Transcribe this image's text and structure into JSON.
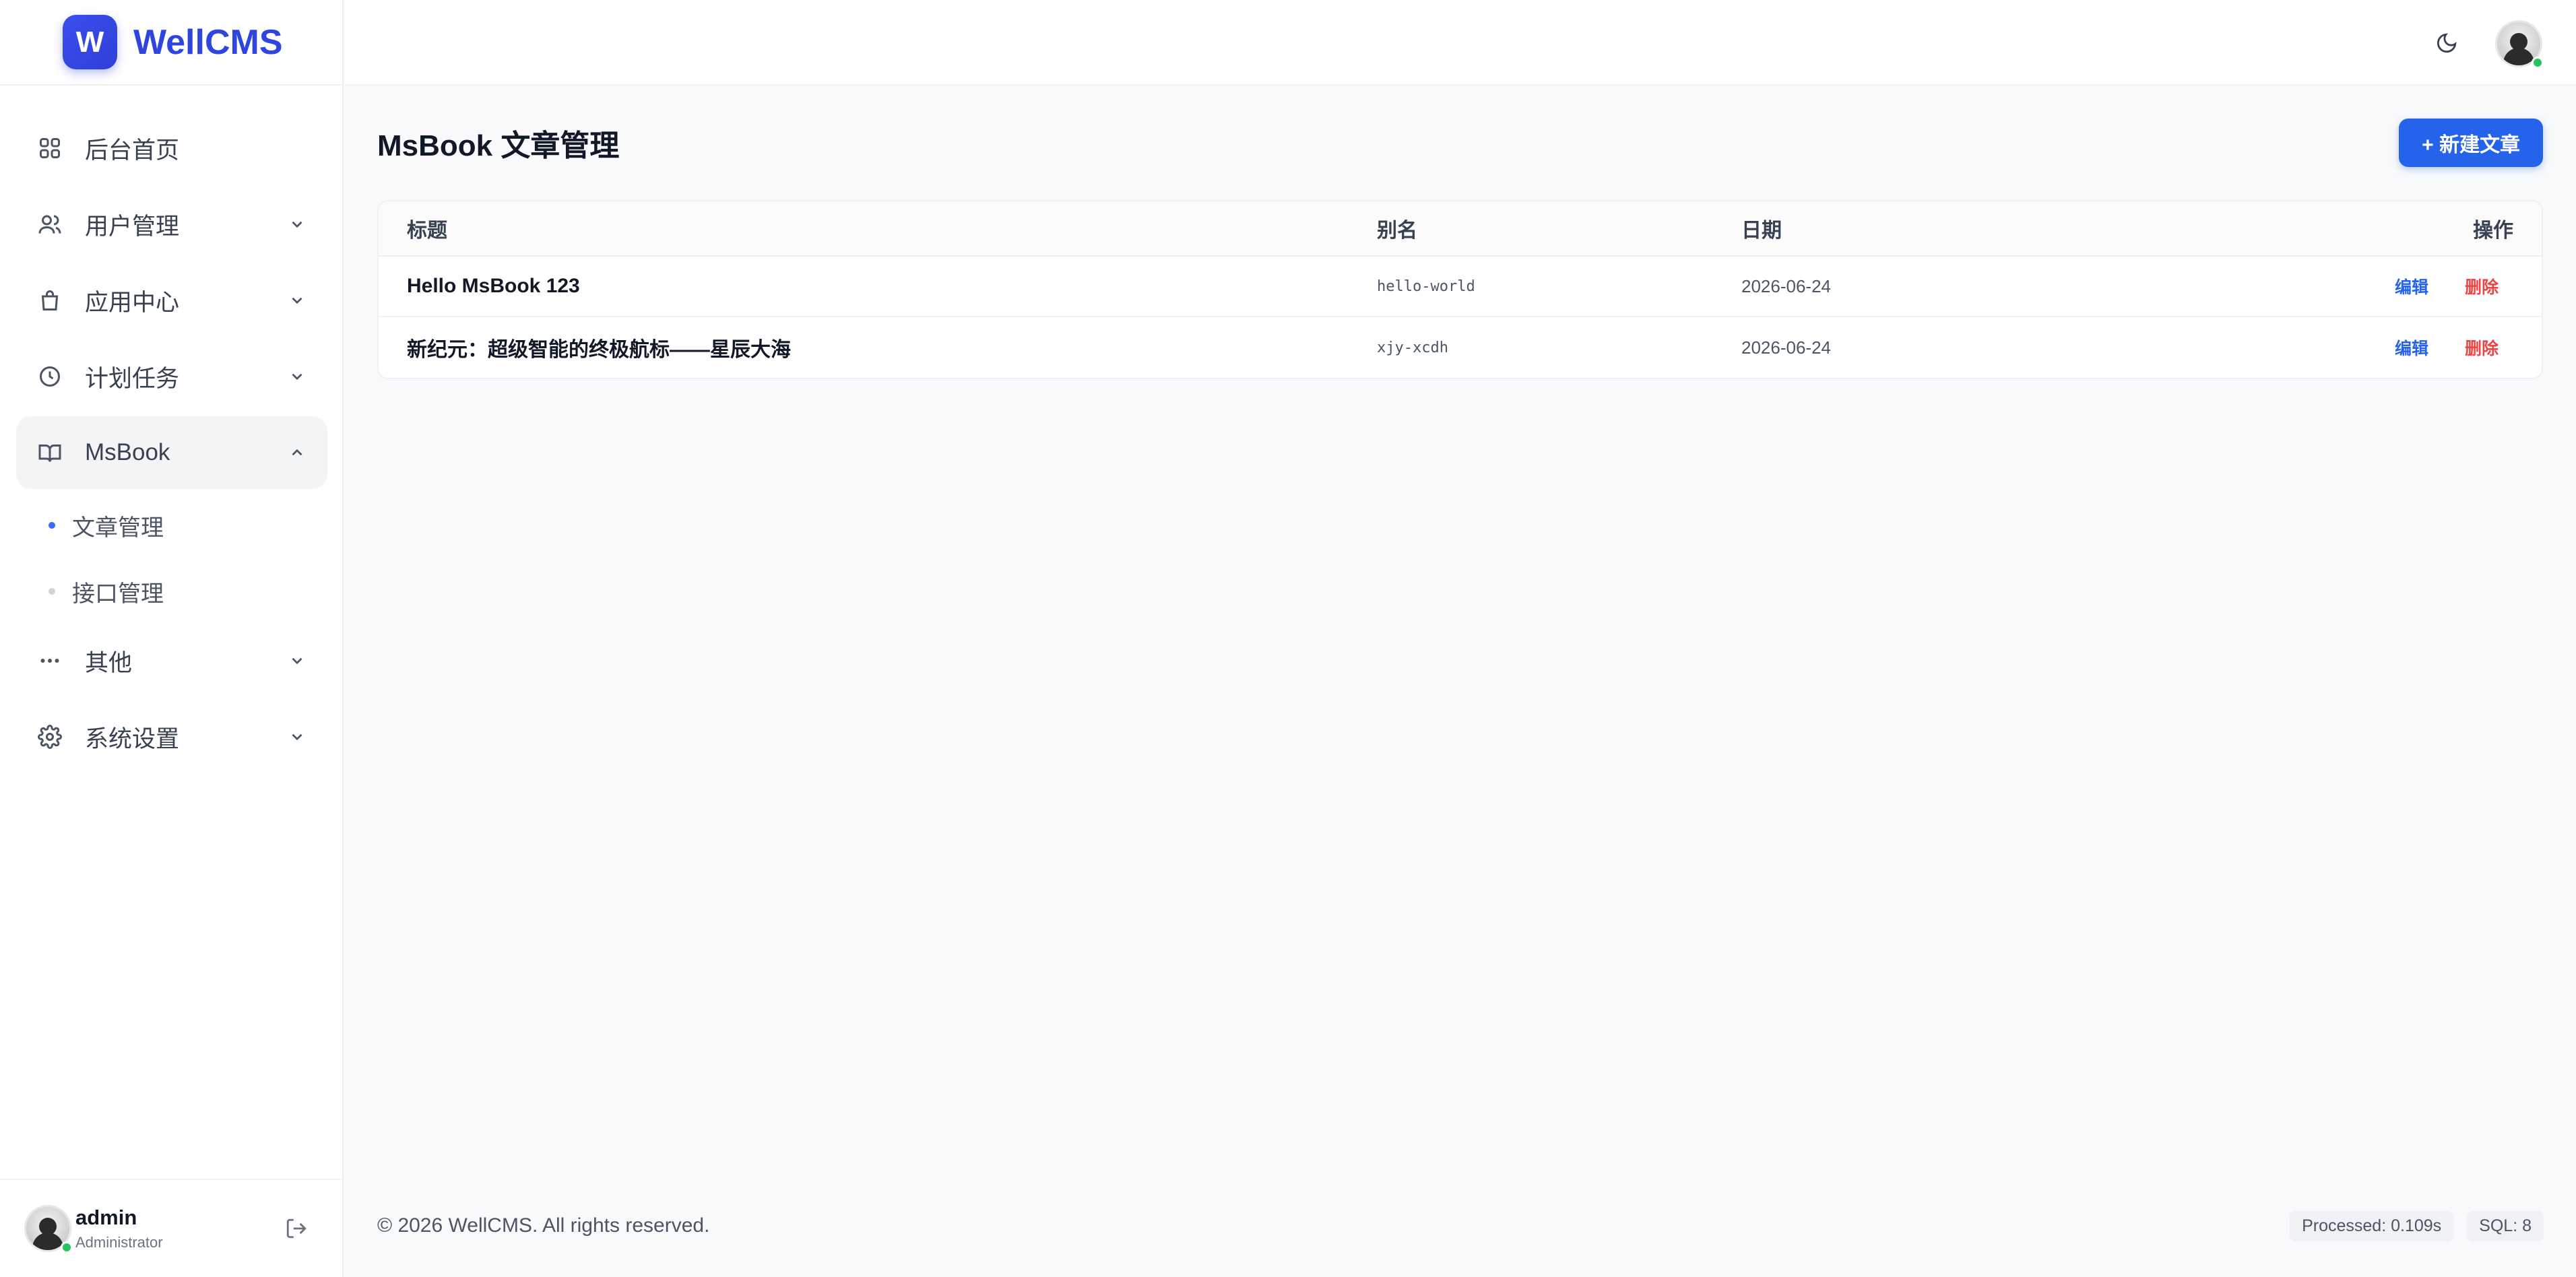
{
  "brand": {
    "logo_letter": "W",
    "name": "WellCMS"
  },
  "nav": {
    "items": [
      {
        "label": "后台首页"
      },
      {
        "label": "用户管理"
      },
      {
        "label": "应用中心"
      },
      {
        "label": "计划任务"
      },
      {
        "label": "MsBook"
      },
      {
        "label": "其他"
      },
      {
        "label": "系统设置"
      }
    ],
    "msbook_sub": [
      {
        "label": "文章管理"
      },
      {
        "label": "接口管理"
      }
    ]
  },
  "user": {
    "name": "admin",
    "role": "Administrator"
  },
  "page": {
    "title": "MsBook 文章管理",
    "new_button": "+ 新建文章"
  },
  "table": {
    "headers": {
      "title": "标题",
      "alias": "别名",
      "date": "日期",
      "ops": "操作"
    },
    "rows": [
      {
        "title": "Hello MsBook 123",
        "alias": "hello-world",
        "date": "2026-06-24",
        "edit": "编辑",
        "delete": "删除"
      },
      {
        "title": "新纪元：超级智能的终极航标——星辰大海",
        "alias": "xjy-xcdh",
        "date": "2026-06-24",
        "edit": "编辑",
        "delete": "删除"
      }
    ]
  },
  "footer": {
    "copyright": "© 2026 WellCMS. All rights reserved.",
    "processed": "Processed: 0.109s",
    "sql": "SQL: 8"
  },
  "colors": {
    "accent": "#2563eb",
    "brand": "#2f45e0",
    "danger": "#ef4444",
    "online": "#22c55e"
  }
}
